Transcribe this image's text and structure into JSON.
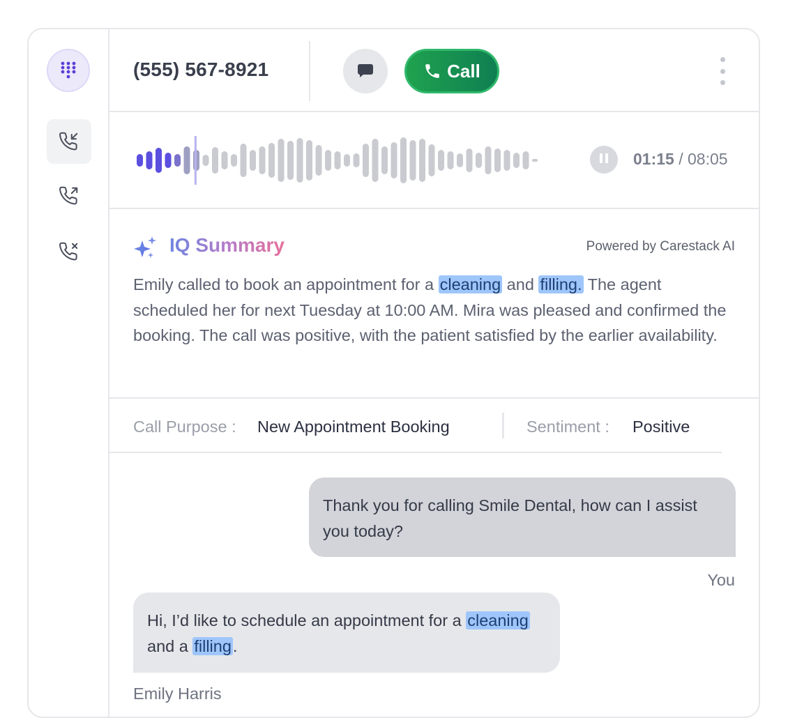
{
  "header": {
    "phone_number": "(555) 567-8921",
    "call_label": "Call",
    "icons": [
      "dialpad-icon",
      "incoming-call-icon",
      "outgoing-call-icon",
      "missed-call-icon",
      "message-icon",
      "phone-icon",
      "more-vertical-icon"
    ]
  },
  "player": {
    "current_time": "01:15",
    "separator": " / ",
    "total_time": "08:05",
    "progress": 0.155
  },
  "summary": {
    "title": "IQ Summary",
    "powered_by": "Powered by Carestack AI",
    "text_parts": [
      "Emily called to book an appointment for a ",
      "cleaning",
      " and ",
      "filling.",
      " The agent scheduled her for next Tuesday at 10:00 AM. Mira was pleased and confirmed the booking. The call was positive, with the patient satisfied by the earlier availability."
    ]
  },
  "meta": {
    "purpose_label": "Call Purpose :",
    "purpose_value": "New Appointment Booking",
    "sentiment_label": "Sentiment :",
    "sentiment_value": "Positive"
  },
  "transcript": {
    "agent_message": "Thank you for calling Smile Dental, how can I assist you today?",
    "agent_name": "You",
    "caller_parts": [
      "Hi, I’d like to schedule an appointment for a ",
      "cleaning",
      " and a ",
      "filling",
      "."
    ],
    "caller_name": "Emily Harris"
  },
  "colors": {
    "call_green": "#1fa24f",
    "highlight": "#9fc6fb",
    "wave_played": "#5b4fe0",
    "wave_unplayed": "#c9cbd0"
  }
}
